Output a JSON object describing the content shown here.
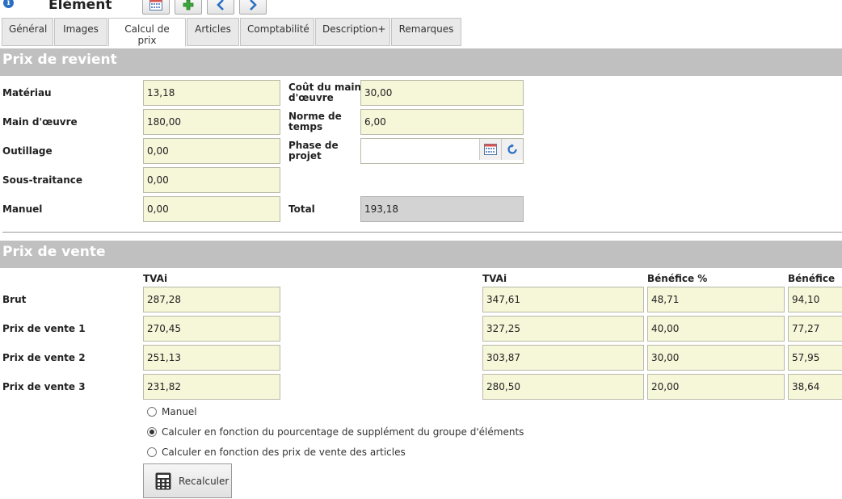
{
  "header": {
    "title": "Elément"
  },
  "tabs": [
    {
      "label": "Général"
    },
    {
      "label": "Images"
    },
    {
      "label": "Calcul de prix"
    },
    {
      "label": "Articles"
    },
    {
      "label": "Comptabilité"
    },
    {
      "label": "Description+"
    },
    {
      "label": "Remarques"
    }
  ],
  "cost": {
    "section_title": "Prix de revient",
    "materiau": {
      "label": "Matériau",
      "value": "13,18"
    },
    "main_oeuvre": {
      "label": "Main d'œuvre",
      "value": "180,00"
    },
    "outillage": {
      "label": "Outillage",
      "value": "0,00"
    },
    "sous_traitance": {
      "label": "Sous-traitance",
      "value": "0,00"
    },
    "manuel": {
      "label": "Manuel",
      "value": "0,00"
    },
    "cout_main": {
      "label_line1": "Coût du main",
      "label_line2": "d'œuvre",
      "value": "30,00"
    },
    "norme": {
      "label_line1": "Norme de",
      "label_line2": "temps",
      "value": "6,00"
    },
    "phase": {
      "label_line1": "Phase de",
      "label_line2": "projet",
      "value": ""
    },
    "total": {
      "label": "Total",
      "value": "193,18"
    }
  },
  "sale": {
    "section_title": "Prix de vente",
    "headers": {
      "col1": "TVAi",
      "col2": "TVAi",
      "col3": "Bénéfice %",
      "col4": "Bénéfice"
    },
    "rows": [
      {
        "label": "Brut",
        "c1": "287,28",
        "c2": "347,61",
        "c3": "48,71",
        "c4": "94,10"
      },
      {
        "label": "Prix de vente 1",
        "c1": "270,45",
        "c2": "327,25",
        "c3": "40,00",
        "c4": "77,27"
      },
      {
        "label": "Prix de vente 2",
        "c1": "251,13",
        "c2": "303,87",
        "c3": "30,00",
        "c4": "57,95"
      },
      {
        "label": "Prix de vente 3",
        "c1": "231,82",
        "c2": "280,50",
        "c3": "20,00",
        "c4": "38,64"
      }
    ],
    "options": [
      {
        "label": "Manuel",
        "selected": false
      },
      {
        "label": "Calculer en fonction du pourcentage de supplément du groupe d'éléments",
        "selected": true
      },
      {
        "label": "Calculer en fonction des prix de vente des articles",
        "selected": false
      }
    ],
    "recalc_label": "Recalculer"
  },
  "icons": {
    "info": "info-icon",
    "calendar": "calendar-icon",
    "add": "plus-icon",
    "prev": "chevron-left-icon",
    "next": "chevron-right-icon",
    "refresh": "refresh-icon",
    "calculator": "calculator-icon"
  },
  "colors": {
    "field_bg": "#f6f6d9",
    "section_bar": "#c0c0c0",
    "accent_blue": "#2a6fc4",
    "add_green": "#3aa63a"
  }
}
